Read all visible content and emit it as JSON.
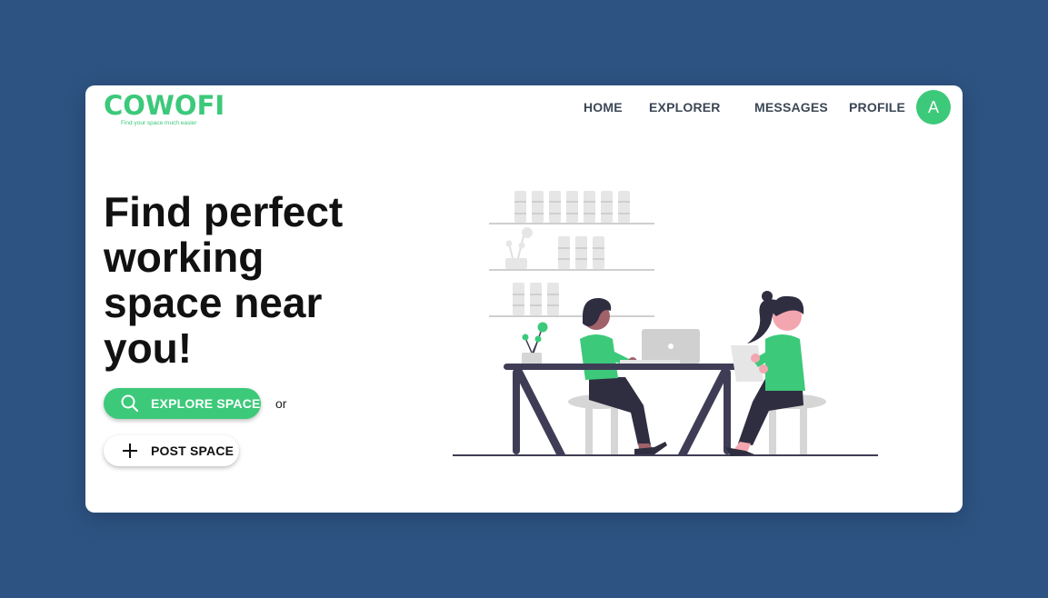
{
  "brand": {
    "name": "COWOFI",
    "tagline": "Find your space much easier"
  },
  "nav": {
    "home": "HOME",
    "explorer": "EXPLORER",
    "messages": "MESSAGES",
    "profile": "PROFILE"
  },
  "user": {
    "avatar_initial": "A"
  },
  "hero": {
    "headline": "Find perfect working space near you!"
  },
  "actions": {
    "explore_label": "EXPLORE SPACE",
    "or_text": "or",
    "post_label": "POST SPACE"
  },
  "colors": {
    "accent": "#3cc97a",
    "background": "#2d5382",
    "card": "#ffffff",
    "text": "#111111"
  },
  "icons": [
    "search-icon",
    "plus-icon"
  ]
}
